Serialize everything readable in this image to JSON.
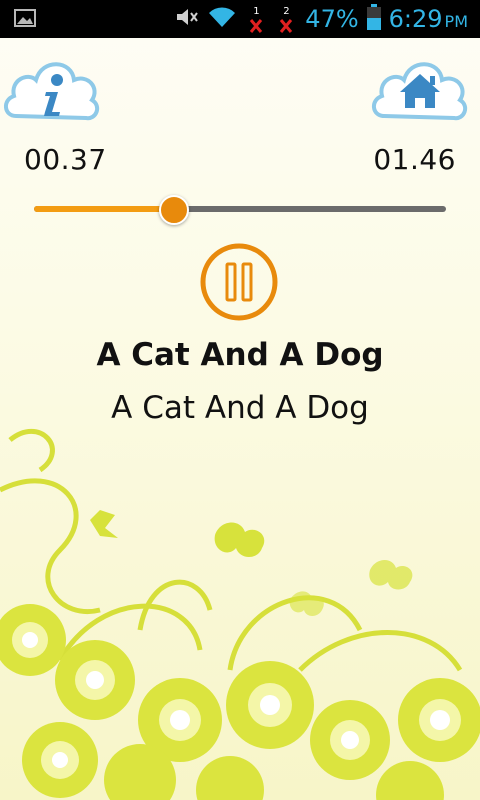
{
  "status_bar": {
    "battery_percent": "47%",
    "time": "6:29",
    "ampm": "PM",
    "sim1_label": "1",
    "sim2_label": "2"
  },
  "player": {
    "elapsed": "00.37",
    "total": "01.46",
    "progress_fraction": 0.34,
    "state": "playing"
  },
  "track": {
    "title": "A Cat And A Dog",
    "subtitle": "A Cat And A Dog"
  },
  "colors": {
    "accent": "#f39c12",
    "status_text": "#33b5e5",
    "track_bg": "#6b6b6b",
    "cloud_fill": "#ffffff",
    "cloud_stroke": "#8ec9e8",
    "icon_blue": "#3b88c4",
    "flower": "#d8e23a"
  },
  "icons": {
    "info": "info-icon",
    "home": "home-icon",
    "pause": "pause-icon"
  }
}
